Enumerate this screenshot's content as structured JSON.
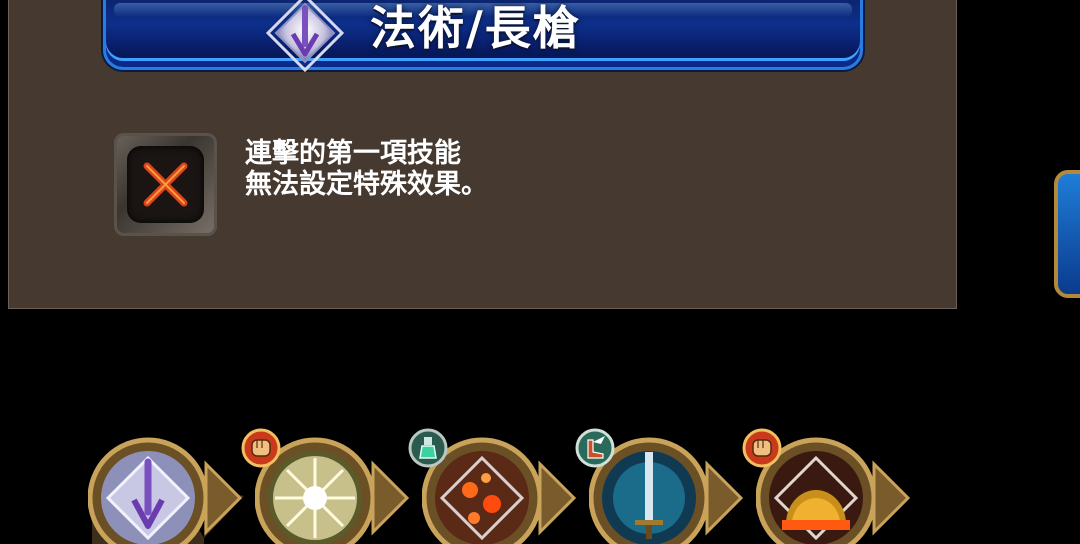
{
  "panel": {
    "title": "法術/長槍",
    "title_icon": "spear-element-emblem-icon",
    "message_line1": "連擊的第一項技能",
    "message_line2": "無法設定特殊效果。",
    "disabled_icon": "red-x-icon"
  },
  "side_button": {
    "icon": "blue-button-edge"
  },
  "skills": [
    {
      "icon": "spear-element-emblem-icon",
      "badge": ""
    },
    {
      "icon": "light-burst-icon",
      "badge": "fist-icon"
    },
    {
      "icon": "fire-sparks-icon",
      "badge": "potion-flask-icon"
    },
    {
      "icon": "blue-sword-icon",
      "badge": "winged-boot-icon"
    },
    {
      "icon": "fire-dome-icon",
      "badge": "fist-icon"
    }
  ],
  "colors": {
    "panel_bg": "#463930",
    "banner_blue": "#0d2f8a",
    "banner_border": "#2a7de0",
    "slot_gold": "#b08d4a"
  }
}
